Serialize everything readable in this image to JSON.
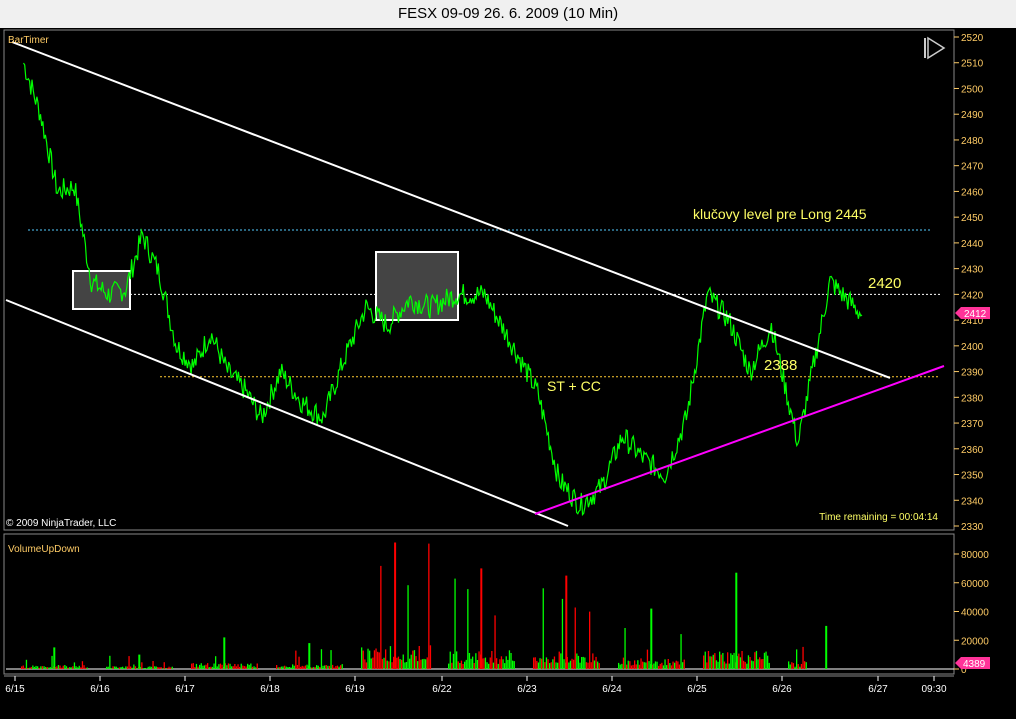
{
  "window": {
    "title": "FESX 09-09  26. 6. 2009 (10 Min)"
  },
  "price_panel": {
    "indicator_label": "BarTimer",
    "copyright": "© 2009 NinjaTrader, LLC",
    "time_remaining": "Time remaining = 00:04:14",
    "last_price_tag": "2412",
    "icon": "play-pause-icon"
  },
  "volume_panel": {
    "label": "VolumeUpDown",
    "last_volume_tag": "4389"
  },
  "annotations": {
    "key_level": "klučovy level pre Long 2445",
    "level_2420": "2420",
    "level_2388": "2388",
    "st_cc": "ST + CC"
  },
  "colors": {
    "price": "#00ff00",
    "trendline": "#ffffff",
    "support_line": "#ff00ff",
    "volume_up": "#00ff00",
    "volume_down": "#ff0000",
    "annotation_text": "#ffff66",
    "axis": "#ffcc66",
    "price_tag": "#ff3399"
  },
  "chart_data": [
    {
      "type": "line",
      "title": "FESX 09-09  26. 6. 2009 (10 Min)",
      "x_ticks": [
        "6/15",
        "6/16",
        "6/17",
        "6/18",
        "6/19",
        "6/22",
        "6/23",
        "6/24",
        "6/25",
        "6/26",
        "6/27",
        "09:30"
      ],
      "y_ticks": [
        2330,
        2340,
        2350,
        2360,
        2370,
        2380,
        2390,
        2400,
        2410,
        2420,
        2430,
        2440,
        2450,
        2460,
        2470,
        2480,
        2490,
        2500,
        2510,
        2520
      ],
      "ylim": [
        2327,
        2522
      ],
      "grid": false,
      "last_price": 2412,
      "horizontal_levels": [
        {
          "label": "klučovy level pre Long 2445",
          "value": 2445
        },
        {
          "label": "2420",
          "value": 2420
        },
        {
          "label": "2388",
          "value": 2388
        }
      ],
      "series": [
        {
          "x": [
            "6/15",
            "6/15",
            "6/15",
            "6/15",
            "6/15",
            "6/16",
            "6/16",
            "6/16",
            "6/16",
            "6/16",
            "6/17",
            "6/17",
            "6/17",
            "6/17",
            "6/17",
            "6/18",
            "6/18",
            "6/18",
            "6/18",
            "6/19",
            "6/19",
            "6/19",
            "6/19",
            "6/22",
            "6/22",
            "6/22",
            "6/23",
            "6/23",
            "6/23",
            "6/23",
            "6/24",
            "6/24",
            "6/24",
            "6/24",
            "6/25",
            "6/25",
            "6/25",
            "6/25",
            "6/26",
            "6/26",
            "6/26"
          ],
          "values": [
            2510,
            2490,
            2460,
            2462,
            2425,
            2420,
            2422,
            2443,
            2428,
            2400,
            2392,
            2405,
            2390,
            2383,
            2372,
            2390,
            2378,
            2372,
            2395,
            2415,
            2408,
            2418,
            2415,
            2420,
            2420,
            2400,
            2382,
            2348,
            2338,
            2345,
            2365,
            2356,
            2350,
            2372,
            2420,
            2410,
            2390,
            2408,
            2362,
            2425,
            2412
          ]
        }
      ]
    },
    {
      "type": "bar",
      "title": "VolumeUpDown",
      "y_ticks": [
        0,
        20000,
        40000,
        60000,
        80000
      ],
      "ylim": [
        0,
        92000
      ],
      "last_volume": 4389,
      "series": [
        {
          "name": "",
          "x": [
            "6/15",
            "6/16",
            "6/17",
            "6/18",
            "6/19",
            "6/22",
            "6/23",
            "6/24",
            "6/25",
            "6/26"
          ],
          "values": [
            15000,
            10000,
            22000,
            18000,
            88000,
            70000,
            65000,
            42000,
            67000,
            30000
          ]
        }
      ]
    }
  ]
}
